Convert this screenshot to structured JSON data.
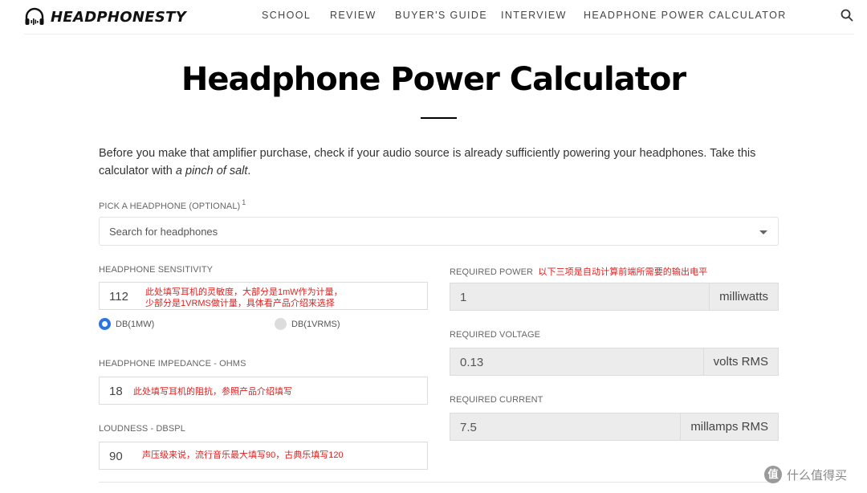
{
  "header": {
    "logo_text": "HEADPHONESTY",
    "nav": [
      "SCHOOL",
      "REVIEW",
      "BUYER'S GUIDE",
      "INTERVIEW",
      "HEADPHONE POWER CALCULATOR"
    ],
    "search_icon": "search-icon"
  },
  "page": {
    "title": "Headphone Power Calculator",
    "intro_before": "Before you make that amplifier purchase, check if your audio source is already sufficiently powering your headphones. Take this calculator with ",
    "intro_em": "a pinch of salt",
    "intro_after": "."
  },
  "pick": {
    "label": "PICK A HEADPHONE (OPTIONAL)",
    "footnote": "1",
    "placeholder": "Search for headphones"
  },
  "sensitivity": {
    "label": "HEADPHONE SENSITIVITY",
    "value": "112",
    "note_line1": "此处填写耳机的灵敏度，大部分是1mW作为计量，",
    "note_line2": "少部分是1VRMS做计量，具体看产品介绍来选择",
    "radio_1mw": "DB(1MW)",
    "radio_1vrms": "DB(1VRMS)"
  },
  "impedance": {
    "label": "HEADPHONE IMPEDANCE - OHMS",
    "value": "18",
    "note": "此处填写耳机的阻抗，参照产品介绍填写"
  },
  "loudness": {
    "label": "LOUDNESS - DBSPL",
    "value": "90",
    "note": "声压级来说，流行音乐最大填写90，古典乐填写120"
  },
  "power": {
    "label": "REQUIRED POWER",
    "note": "以下三项是自动计算前端所需要的输出电平",
    "value": "1",
    "unit": "milliwatts"
  },
  "voltage": {
    "label": "REQUIRED VOLTAGE",
    "value": "0.13",
    "unit": "volts RMS"
  },
  "current": {
    "label": "REQUIRED CURRENT",
    "value": "7.5",
    "unit": "millamps RMS"
  },
  "watermark": {
    "badge": "值",
    "text": "什么值得买"
  },
  "colors": {
    "accent_radio": "#2a73e8",
    "annotation": "#e02020"
  }
}
